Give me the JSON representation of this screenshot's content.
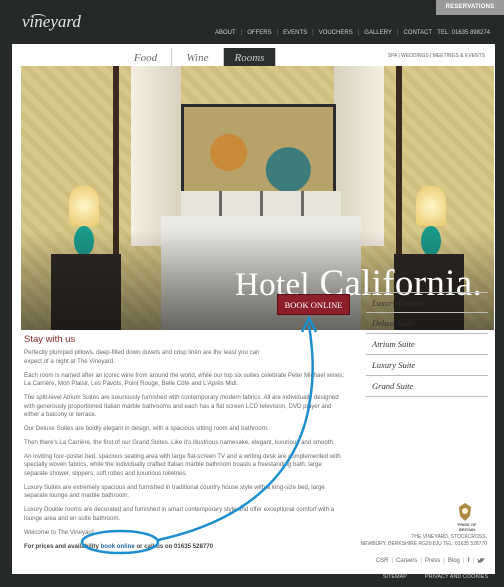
{
  "header": {
    "reservations_label": "RESERVATIONS",
    "logo_text": "vineyard",
    "nav": [
      "ABOUT",
      "OFFERS",
      "EVENTS",
      "VOUCHERS",
      "GALLERY",
      "CONTACT"
    ],
    "tel": "TEL: 01635 898274"
  },
  "tabs": {
    "food": "Food",
    "wine": "Wine",
    "rooms": "Rooms"
  },
  "subnav": "SPA  |  WEDDINGS  |  MEETINGS & EVENTS",
  "hero": {
    "title_hotel": "Hotel",
    "title_name": "California."
  },
  "content": {
    "heading": "Stay with us",
    "book_label": "BOOK ONLINE",
    "p1": "Perfectly plumped pillows, deep-filled down duvets and crisp linen are the least you can expect of a night at The Vineyard.",
    "p2": "Each room is named after an iconic wine from around the world, while our top six suites celebrate Peter Michael wines; La Carrière, Mon Plaisir, Les Pavots, Point Rouge, Belle Côte and L'Après Midi.",
    "p3": "The split-level Atrium Suites are luxuriously furnished with contemporary modern fabrics. All are individually designed with generously proportioned Italian marble bathrooms and each has a flat screen LCD television, DVD player and either a balcony or terrace.",
    "p4": "Our Deluxe Suites are boldly elegant in design, with a spacious sitting room and bathroom.",
    "p5": "Then there's La Carrière, the first of our Grand Suites. Like it's illustrious namesake, elegant, luxurious and smooth.",
    "p6": "An inviting four-poster bed, spacious seating area with large flat-screen TV and a writing desk are complemented with specially woven fabrics, while the individually crafted Italian marble bathroom boasts a freestanding bath, large separate shower, slippers, soft robes and luxurious toiletries.",
    "p7": "Luxury Suites are extremely spacious and furnished in traditional country house style with a king-size bed, large separate lounge and marble bathroom.",
    "p8": "Luxury Double rooms are decorated and furnished in smart contemporary style and offer exceptional comfort with a lounge area and en suite bathroom.",
    "p9": "Welcome to The Vineyard.",
    "p10_a": "For prices and availability ",
    "p10_link": "book online",
    "p10_b": " or call us on 01635 528770"
  },
  "rooms": [
    "Luxury Double",
    "Deluxe Suite",
    "Atrium Suite",
    "Luxury Suite",
    "Grand Suite"
  ],
  "crest_caption": "PRIDE OF BRITAIN",
  "address": {
    "line1": "THE VINEYARD, STOCKCROSS,",
    "line2": "NEWBURY, BERKSHIRE RG20 8JU TEL: 01635 528770"
  },
  "footer_links": {
    "csr": "CSR",
    "careers": "Careers",
    "press": "Press",
    "blog": "Blog"
  },
  "bottom": {
    "sitemap": "SITEMAP",
    "privacy": "PRIVACY AND COOKIES"
  },
  "colors": {
    "accent": "#8d1f2b",
    "annotation": "#1b8fd0",
    "background": "#26292a"
  }
}
